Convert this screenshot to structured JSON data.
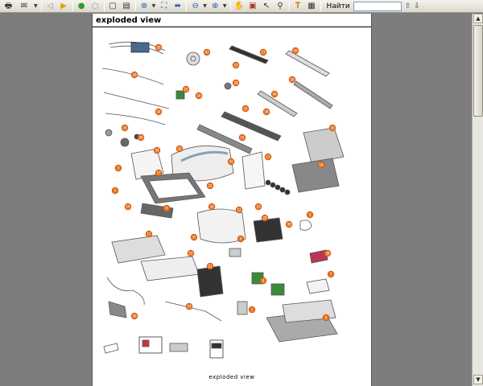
{
  "toolbar": {
    "find_label": "Найти",
    "find_value": "",
    "buttons": [
      "print-icon",
      "email-icon",
      "back-icon",
      "forward-icon",
      "prev-page-icon",
      "next-page-icon",
      "single-page-icon",
      "continuous-page-icon",
      "zoom-in-icon",
      "fit-page-icon",
      "fit-width-icon",
      "zoom-out-icon",
      "zoom-plus-icon",
      "hand-tool-icon",
      "snapshot-icon",
      "select-tool-icon",
      "find-icon",
      "text-select-icon",
      "image-select-icon"
    ]
  },
  "page": {
    "title": "exploded view",
    "footer": "exploded view"
  },
  "callouts": [
    "26",
    "43",
    "27",
    "35",
    "15",
    "18",
    "20",
    "28",
    "25",
    "16",
    "40",
    "24",
    "31",
    "33",
    "34",
    "33",
    "30",
    "34",
    "31",
    "32",
    "41",
    "17",
    "13",
    "3",
    "14",
    "22",
    "5",
    "19",
    "9",
    "36",
    "12",
    "2",
    "29",
    "23",
    "39",
    "37",
    "4",
    "38",
    "11",
    "10",
    "7",
    "21",
    "6",
    "10",
    "1",
    "30",
    "8"
  ]
}
